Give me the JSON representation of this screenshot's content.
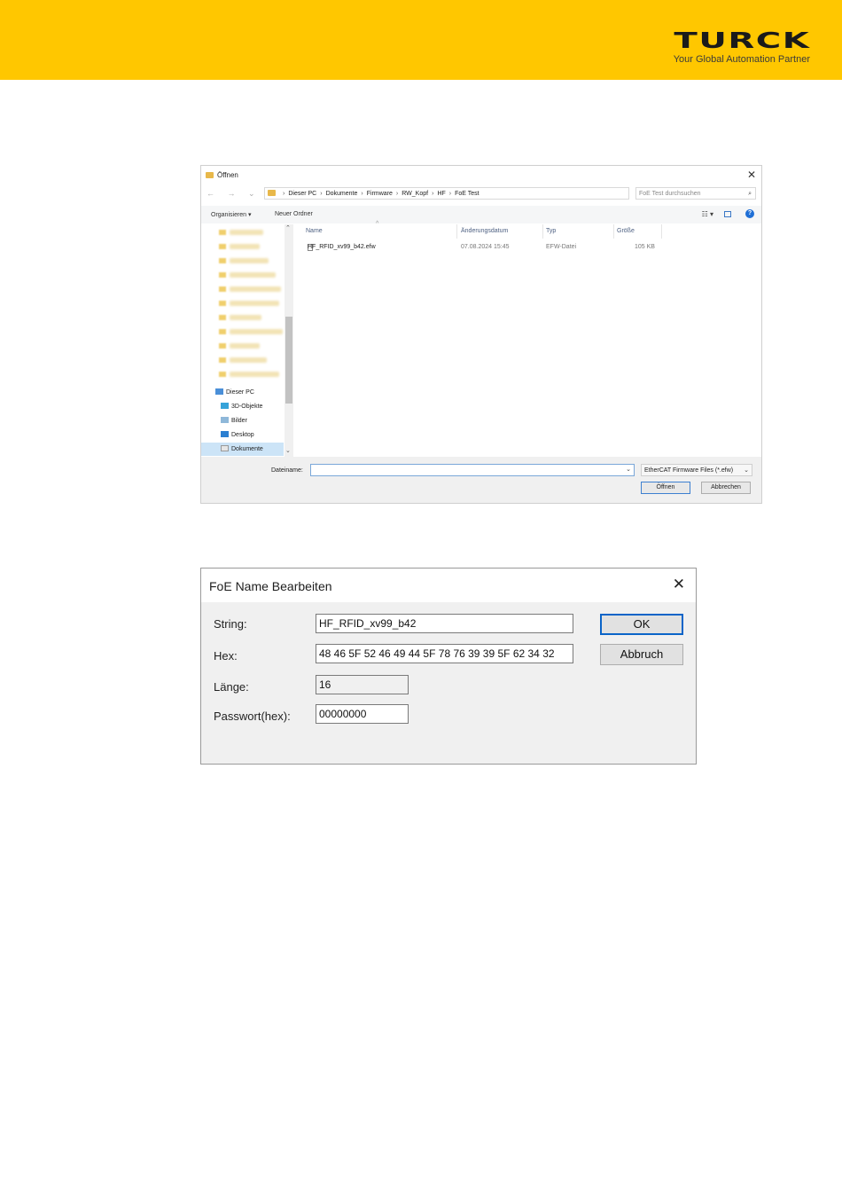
{
  "header": {
    "logo_text": "TURCK",
    "tagline": "Your Global Automation Partner",
    "background_color": "#FFC700"
  },
  "open_dialog": {
    "title": "Öffnen",
    "close_glyph": "✕",
    "nav_buttons": "← → ⌄ ↑",
    "path": [
      "Dieser PC",
      "Dokumente",
      "Firmware",
      "RW_Kopf",
      "HF",
      "FoE Test"
    ],
    "path_separator": "›",
    "search_placeholder": "FoE Test durchsuchen",
    "toolbar": {
      "organize": "Organisieren ▾",
      "new_folder": "Neuer Ordner"
    },
    "nav_items": [
      {
        "label": "Dieser PC",
        "icon": "computer-icon"
      },
      {
        "label": "3D-Objekte",
        "icon": "3d-objects-icon"
      },
      {
        "label": "Bilder",
        "icon": "pictures-icon"
      },
      {
        "label": "Desktop",
        "icon": "desktop-icon"
      },
      {
        "label": "Dokumente",
        "icon": "documents-icon"
      }
    ],
    "columns": {
      "name": "Name",
      "date": "Änderungsdatum",
      "type": "Typ",
      "size": "Größe"
    },
    "files": [
      {
        "name": "HF_RFID_xv99_b42.efw",
        "date": "07.08.2024 15:45",
        "type": "EFW-Datei",
        "size": "105 KB"
      }
    ],
    "filename_label": "Dateiname:",
    "filename_value": "",
    "filter": "EtherCAT Firmware Files (*.efw)",
    "open_button": "Öffnen",
    "cancel_button": "Abbrechen"
  },
  "foe_dialog": {
    "title": "FoE Name Bearbeiten",
    "close_glyph": "✕",
    "fields": {
      "string_label": "String:",
      "string_value": "HF_RFID_xv99_b42",
      "hex_label": "Hex:",
      "hex_value": "48 46 5F 52 46 49 44 5F 78 76 39 39 5F 62 34 32",
      "length_label": "Länge:",
      "length_value": "16",
      "password_label": "Passwort(hex):",
      "password_value": "00000000"
    },
    "ok_button": "OK",
    "cancel_button": "Abbruch"
  }
}
